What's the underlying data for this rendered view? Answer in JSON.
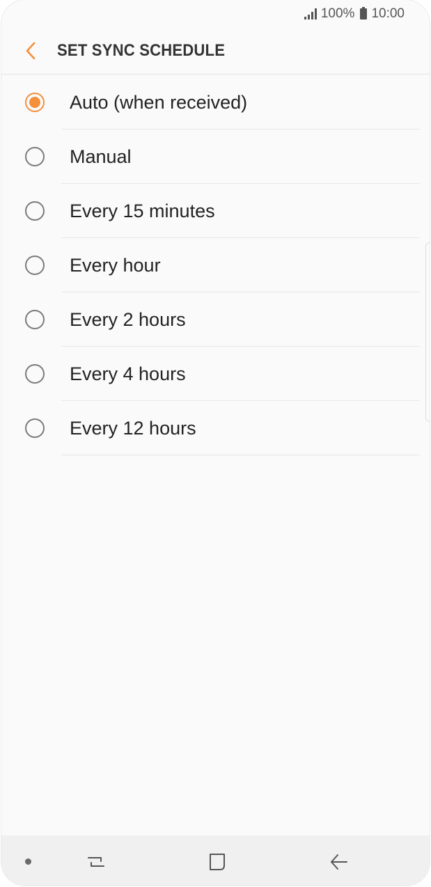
{
  "status_bar": {
    "battery": "100%",
    "time": "10:00"
  },
  "header": {
    "title": "SET SYNC SCHEDULE",
    "back_icon": "chevron-left-icon"
  },
  "options": [
    {
      "label": "Auto (when received)",
      "selected": true
    },
    {
      "label": "Manual",
      "selected": false
    },
    {
      "label": "Every 15 minutes",
      "selected": false
    },
    {
      "label": "Every hour",
      "selected": false
    },
    {
      "label": "Every 2 hours",
      "selected": false
    },
    {
      "label": "Every 4 hours",
      "selected": false
    },
    {
      "label": "Every 12 hours",
      "selected": false
    }
  ],
  "nav_bar": {
    "icons": [
      "dot-icon",
      "recent-apps-icon",
      "home-icon",
      "back-arrow-icon"
    ]
  },
  "colors": {
    "accent": "#f48f3c",
    "background": "#fafafa",
    "nav_background": "#f0f0f0"
  }
}
